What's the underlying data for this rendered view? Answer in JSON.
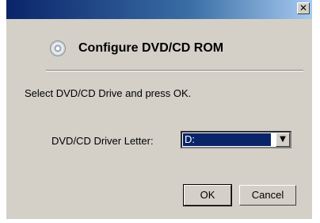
{
  "window": {
    "close_glyph": "✕"
  },
  "header": {
    "title": "Configure DVD/CD ROM",
    "icon": "cd-icon"
  },
  "instruction": "Select DVD/CD Drive and press OK.",
  "drive": {
    "label": "DVD/CD Driver Letter:",
    "selected": "D:",
    "arrow_glyph": "▼"
  },
  "buttons": {
    "ok_label": "OK",
    "cancel_label": "Cancel"
  }
}
